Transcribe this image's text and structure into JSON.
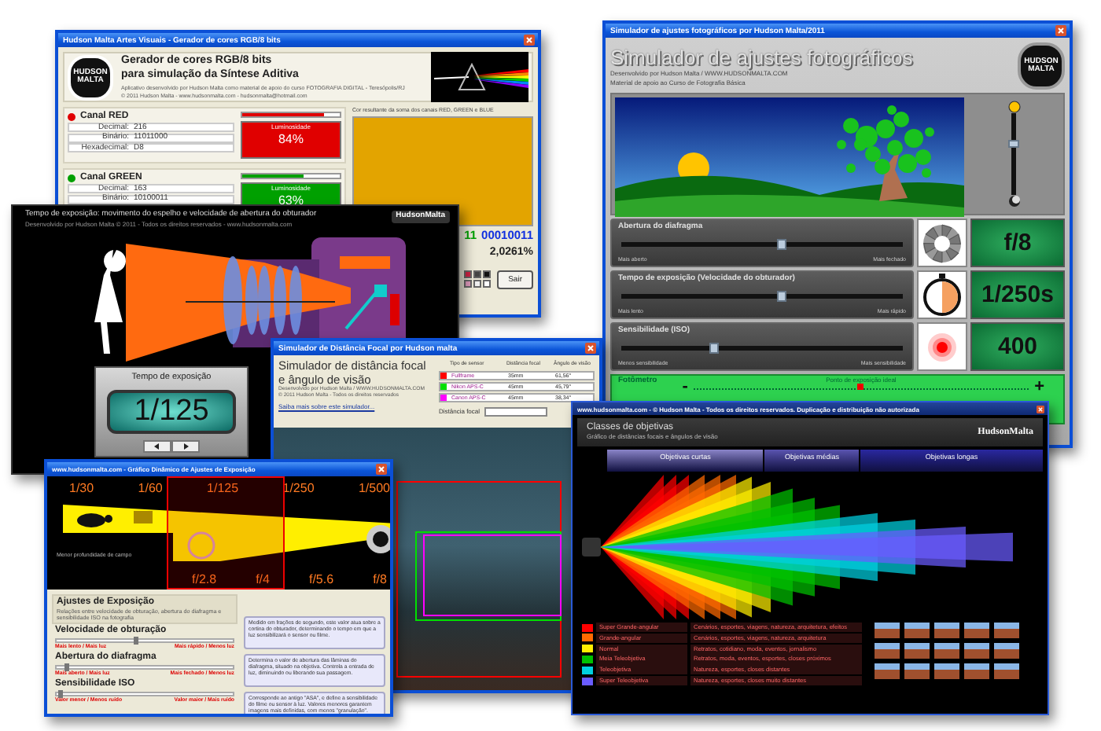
{
  "rgb_generator": {
    "title": "Hudson Malta Artes Visuais - Gerador de cores RGB/8 bits",
    "logo": "HUDSON MALTA",
    "heading": [
      "Gerador de cores RGB/8 bits",
      "para simulação da Síntese Aditiva"
    ],
    "credits": [
      "Aplicativo desenvolvido por Hudson Malta como material de apoio do curso FOTOGRAFIA DIGITAL - Teresópolis/RJ",
      "© 2011 Hudson Malta - www.hudsonmalta.com - hudsonmalta@hotmail.com"
    ],
    "channels": [
      {
        "name": "Canal RED",
        "color": "#e00000",
        "fields": [
          {
            "label": "Decimal:",
            "value": "216"
          },
          {
            "label": "Binário:",
            "value": "11011000"
          },
          {
            "label": "Hexadecimal:",
            "value": "D8"
          }
        ],
        "caption": "Luminosidade",
        "reading": "84%",
        "level": 0.84
      },
      {
        "name": "Canal GREEN",
        "color": "#00a000",
        "fields": [
          {
            "label": "Decimal:",
            "value": "163"
          },
          {
            "label": "Binário:",
            "value": "10100011"
          }
        ],
        "caption": "Luminosidade",
        "reading": "63%",
        "level": 0.63
      }
    ],
    "result_caption": "Cor resultante da soma dos canais RED, GREEN e BLUE",
    "binary": [
      {
        "text": "11",
        "color": "#00a000"
      },
      {
        "text": "00010011",
        "color": "#1030e0"
      }
    ],
    "percentage": "2,0261%",
    "button": "Sair"
  },
  "photo_simulator": {
    "title": "Simulador de ajustes fotográficos por Hudson Malta/2011",
    "heading": "Simulador de ajustes fotográficos",
    "credits": [
      "Desenvolvido por Hudson Malta / WWW.HUDSONMALTA.COM",
      "Material de apoio ao Curso de Fotografia Básica"
    ],
    "logo": "HUDSON MALTA",
    "light": {
      "level": 0.62
    },
    "controls": [
      {
        "kind": "aperture",
        "label": "Abertura do diafragma",
        "min_label": "Mais aberto",
        "max_label": "Mais fechado",
        "level": 0.57,
        "value": "f/8"
      },
      {
        "kind": "shutter",
        "label": "Tempo de exposição (Velocidade do obturador)",
        "min_label": "Mais lento",
        "max_label": "Mais rápido",
        "level": 0.57,
        "value": "1/250s"
      },
      {
        "kind": "iso",
        "label": "Sensibilidade (ISO)",
        "min_label": "Menos sensibilidade",
        "max_label": "Mais sensibilidade",
        "level": 0.33,
        "value": "400"
      }
    ],
    "meter": {
      "label": "Fotômetro",
      "minus": "-",
      "plus": "+",
      "ideal": "Ponto de exposição ideal",
      "level": 0.5
    }
  },
  "shutter_animation": {
    "title": "Tempo de exposição: movimento do espelho e velocidade de abertura do obturador",
    "subtitle": "Desenvolvido por Hudson Malta © 2011 - Todos os direitos reservados - www.hudsonmalta.com",
    "logo": "HudsonMalta",
    "panel_label": "Tempo de exposição",
    "value": "1/125"
  },
  "focal_simulator": {
    "title": "Simulador de Distância Focal por Hudson malta",
    "heading": [
      "Simulador de distância focal",
      "e ângulo de visão"
    ],
    "credits": [
      "Desenvolvido por Hudson Malta / WWW.HUDSONMALTA.COM",
      "© 2011 Hudson Malta - Todos os direitos reservados"
    ],
    "link": "Saiba mais sobre este simulador...",
    "columns": [
      "Tipo de sensor",
      "Distância focal",
      "Ângulo de visão"
    ],
    "sensors": [
      {
        "color": "#ff0000",
        "name": "Fullframe",
        "focal": "35mm",
        "angle": "61,56°"
      },
      {
        "color": "#00e000",
        "name": "Nikon APS-C",
        "focal": "45mm",
        "angle": "45,79°"
      },
      {
        "color": "#ff00ff",
        "name": "Canon APS-C",
        "focal": "45mm",
        "angle": "38,34°"
      }
    ],
    "focal_label": "Distância focal"
  },
  "exposure_chart": {
    "title": "www.hudsonmalta.com - Gráfico Dinâmico de Ajustes de Exposição",
    "speeds": [
      "1/30",
      "1/60",
      "1/125",
      "1/250",
      "1/500"
    ],
    "apertures": [
      "f/2.8",
      "f/4",
      "f/5.6",
      "f/8"
    ],
    "depth_note": "Menor profundidade de campo",
    "heading": "Ajustes de Exposição",
    "subheading": "Relações entre velocidade de obturação, abertura do diafragma e sensibilidade ISO na fotografia",
    "settings": [
      {
        "label": "Velocidade de obturação",
        "level": 0.45,
        "min_label": "Mais lento / Mais luz",
        "max_label": "Mais rápido / Menos luz",
        "description": "Medido em frações de segundo, este valor atua sobre a cortina do obturador, determinando o tempo em que a luz sensibilizará o sensor ou filme."
      },
      {
        "label": "Abertura do diafragma",
        "level": 0.05,
        "min_label": "Mais aberto / Mais luz",
        "max_label": "Mais fechado / Menos luz",
        "description": "Determina o valor de abertura das lâminas do diafragma, situado na objetiva. Controla a entrada de luz, diminuindo ou liberando sua passagem."
      },
      {
        "label": "Sensibilidade ISO",
        "level": 0.02,
        "min_label": "Valor menor / Menos ruído",
        "max_label": "Valor maior / Mais ruído",
        "description": "Corresponde ao antigo \"ASA\", e define a sensibilidade do filme ou sensor à luz. Valores menores garantem imagens mais definidas, com menos \"granulação\"."
      }
    ]
  },
  "lens_classes": {
    "title": "www.hudsonmalta.com - © Hudson Malta - Todos os direitos reservados. Duplicação e distribuição não autorizada",
    "heading": "Classes de objetivas",
    "subheading": "Gráfico de distâncias focais e ângulos de visão",
    "logo": "HudsonMalta",
    "groups": [
      "Objetivas curtas",
      "Objetivas médias",
      "Objetivas longas"
    ],
    "classes": [
      {
        "name": "Super Grande-angular",
        "uses": "Cenários, esportes, viagens, natureza, arquitetura, efeitos",
        "color": "#ff0000"
      },
      {
        "name": "Grande-angular",
        "uses": "Cenários, esportes, viagens, natureza, arquitetura",
        "color": "#ff6a00"
      },
      {
        "name": "Normal",
        "uses": "Retratos, cotidiano, moda, eventos, jornalismo",
        "color": "#ffee00"
      },
      {
        "name": "Meia Teleobjetiva",
        "uses": "Retratos, moda, eventos, esportes, closes próximos",
        "color": "#00c000"
      },
      {
        "name": "Teleobjetiva",
        "uses": "Natureza, esportes, closes distantes",
        "color": "#00d0e0"
      },
      {
        "name": "Super Teleobjetiva",
        "uses": "Natureza, esportes, closes muito distantes",
        "color": "#6a5cff"
      }
    ]
  }
}
